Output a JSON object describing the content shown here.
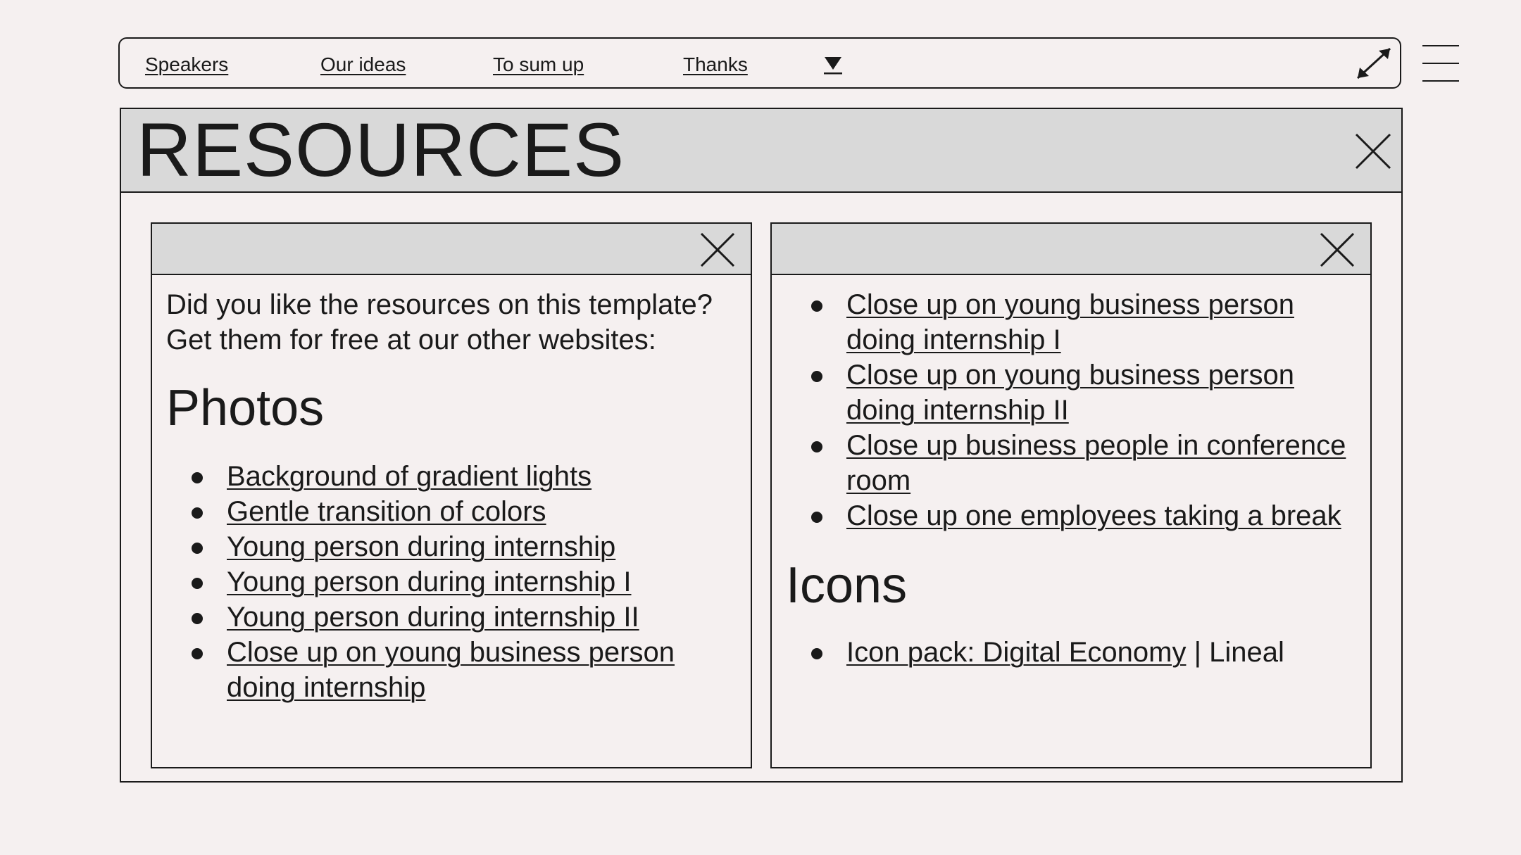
{
  "nav": {
    "links": [
      "Speakers",
      "Our ideas",
      "To sum up",
      "Thanks"
    ],
    "dropdown_icon": "down-triangle-icon",
    "expand_icon": "diagonal-resize-arrow-icon",
    "menu_icon": "hamburger-menu-icon"
  },
  "window": {
    "title": "RESOURCES",
    "close_icon": "close-x-icon"
  },
  "left_panel": {
    "intro": "Did you like the resources on this template? Get them for free at our other websites:",
    "photos_heading": "Photos",
    "photos": [
      "Background of gradient lights",
      "Gentle transition of colors",
      "Young person during internship",
      "Young person during internship I",
      "Young person during internship II",
      "Close up on young business person doing internship"
    ]
  },
  "right_panel": {
    "photos": [
      "Close up on young business person doing internship I",
      "Close up on young business person doing internship II",
      "Close up business people in conference room",
      "Close up one employees taking a break"
    ],
    "icons_heading": "Icons",
    "icons": [
      {
        "link": "Icon pack: Digital Economy",
        "suffix": " | Lineal"
      }
    ]
  },
  "colors": {
    "background": "#f5f0f0",
    "titlebar": "#d9d9d9",
    "ink": "#1a1a1a"
  }
}
